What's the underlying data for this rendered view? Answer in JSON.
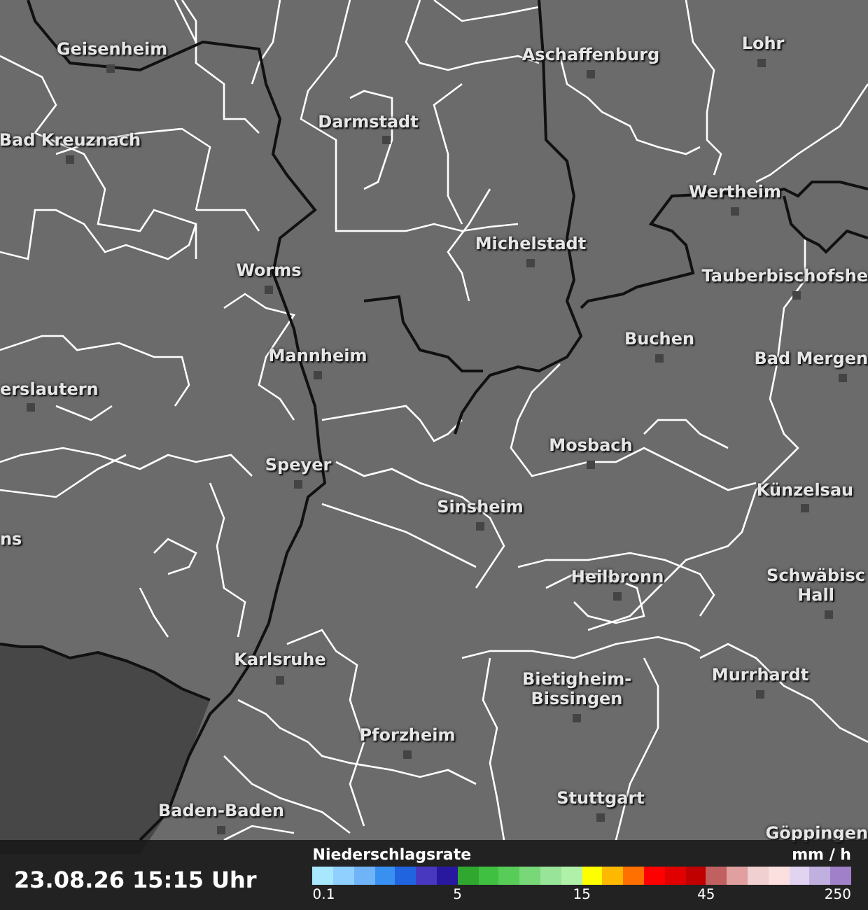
{
  "map": {
    "places": [
      {
        "name": "Lohr"
      },
      {
        "name": "Geisenheim"
      },
      {
        "name": "Aschaffenburg"
      },
      {
        "name": "Darmstadt"
      },
      {
        "name": "Bad Kreuznach"
      },
      {
        "name": "Wertheim"
      },
      {
        "name": "Michelstadt"
      },
      {
        "name": "Worms"
      },
      {
        "name": "Tauberbischofshe"
      },
      {
        "name": "Buchen"
      },
      {
        "name": "Mannheim"
      },
      {
        "name": "Bad Mergen"
      },
      {
        "name": "erslautern"
      },
      {
        "name": "Mosbach"
      },
      {
        "name": "Speyer"
      },
      {
        "name": "Künzelsau"
      },
      {
        "name": "Sinsheim"
      },
      {
        "name": "ns"
      },
      {
        "name": "Heilbronn"
      },
      {
        "name": "Schwäbisc Hall"
      },
      {
        "name": "Karlsruhe"
      },
      {
        "name": "Murrhardt"
      },
      {
        "name": "Bietigheim-Bissingen"
      },
      {
        "name": "Pforzheim"
      },
      {
        "name": "Stuttgart"
      },
      {
        "name": "Baden-Baden"
      },
      {
        "name": "Göppingen"
      }
    ]
  },
  "footer": {
    "timestamp": "23.08.26 15:15 Uhr",
    "legend": {
      "title": "Niederschlagsrate",
      "unit": "mm / h",
      "swatches": [
        {
          "color": "#a8e8ff"
        },
        {
          "color": "#90d0ff"
        },
        {
          "color": "#70b4f8"
        },
        {
          "color": "#3890f0"
        },
        {
          "color": "#2064e0"
        },
        {
          "color": "#4838c0"
        },
        {
          "color": "#2818a0"
        },
        {
          "color": "#30a830"
        },
        {
          "color": "#40c040"
        },
        {
          "color": "#58cc58"
        },
        {
          "color": "#78d878"
        },
        {
          "color": "#98e498"
        },
        {
          "color": "#b0f0a8"
        },
        {
          "color": "#ffff00"
        },
        {
          "color": "#ffb800"
        },
        {
          "color": "#ff7000"
        },
        {
          "color": "#ff0000"
        },
        {
          "color": "#e00000"
        },
        {
          "color": "#c00000"
        },
        {
          "color": "#c06060"
        },
        {
          "color": "#e0a0a0"
        },
        {
          "color": "#f0d0d0"
        },
        {
          "color": "#fce0e0"
        },
        {
          "color": "#e0d4f0"
        },
        {
          "color": "#c0b0e0"
        },
        {
          "color": "#a080c8"
        }
      ],
      "ticks": [
        "0.1",
        "5",
        "15",
        "45",
        "250"
      ]
    }
  }
}
